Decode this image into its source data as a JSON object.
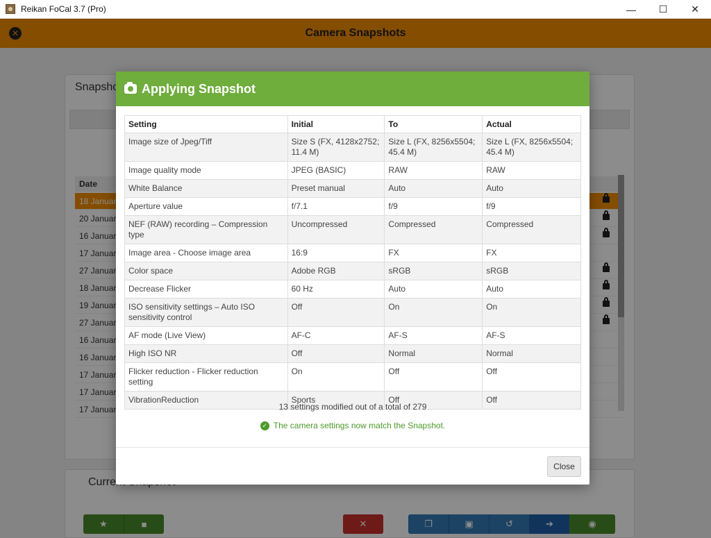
{
  "window": {
    "title": "Reikan FoCal 3.7 (Pro)",
    "minimize": "—",
    "maximize": "☐",
    "close": "✕"
  },
  "header": {
    "title": "Camera Snapshots"
  },
  "background": {
    "snapshots_title": "Snapshot",
    "date_header": "Date",
    "dates": [
      "18 January",
      "20 January",
      "16 January",
      "17 January",
      "27 January",
      "18 January",
      "19 January",
      "27 January",
      "16 January",
      "16 January",
      "17 January",
      "17 January",
      "17 January"
    ],
    "current_title": "Current Snapshot"
  },
  "modal": {
    "title": "Applying Snapshot",
    "columns": [
      "Setting",
      "Initial",
      "To",
      "Actual"
    ],
    "rows": [
      [
        "Image size of Jpeg/Tiff",
        "Size S (FX, 4128x2752; 11.4 M)",
        "Size L (FX, 8256x5504; 45.4 M)",
        "Size L (FX, 8256x5504; 45.4 M)"
      ],
      [
        "Image quality mode",
        "JPEG (BASIC)",
        "RAW",
        "RAW"
      ],
      [
        "White Balance",
        "Preset manual",
        "Auto",
        "Auto"
      ],
      [
        "Aperture value",
        "f/7.1",
        "f/9",
        "f/9"
      ],
      [
        "NEF (RAW) recording – Compression type",
        "Uncompressed",
        "Compressed",
        "Compressed"
      ],
      [
        "Image area - Choose image area",
        "16:9",
        "FX",
        "FX"
      ],
      [
        "Color space",
        "Adobe RGB",
        "sRGB",
        "sRGB"
      ],
      [
        "Decrease Flicker",
        "60 Hz",
        "Auto",
        "Auto"
      ],
      [
        "ISO sensitivity settings – Auto ISO sensitivity control",
        "Off",
        "On",
        "On"
      ],
      [
        "AF mode (Live View)",
        "AF-C",
        "AF-S",
        "AF-S"
      ],
      [
        "High ISO NR",
        "Off",
        "Normal",
        "Normal"
      ],
      [
        "Flicker reduction - Flicker reduction setting",
        "On",
        "Off",
        "Off"
      ],
      [
        "VibrationReduction",
        "Sports",
        "Off",
        "Off"
      ]
    ],
    "summary": "13 settings modified out of a total of 279",
    "match_message": "The camera settings now match the Snapshot.",
    "close_label": "Close"
  },
  "colors": {
    "header_orange": "#f08c00",
    "modal_green": "#6fad3c",
    "success_green": "#4c9a2a"
  }
}
